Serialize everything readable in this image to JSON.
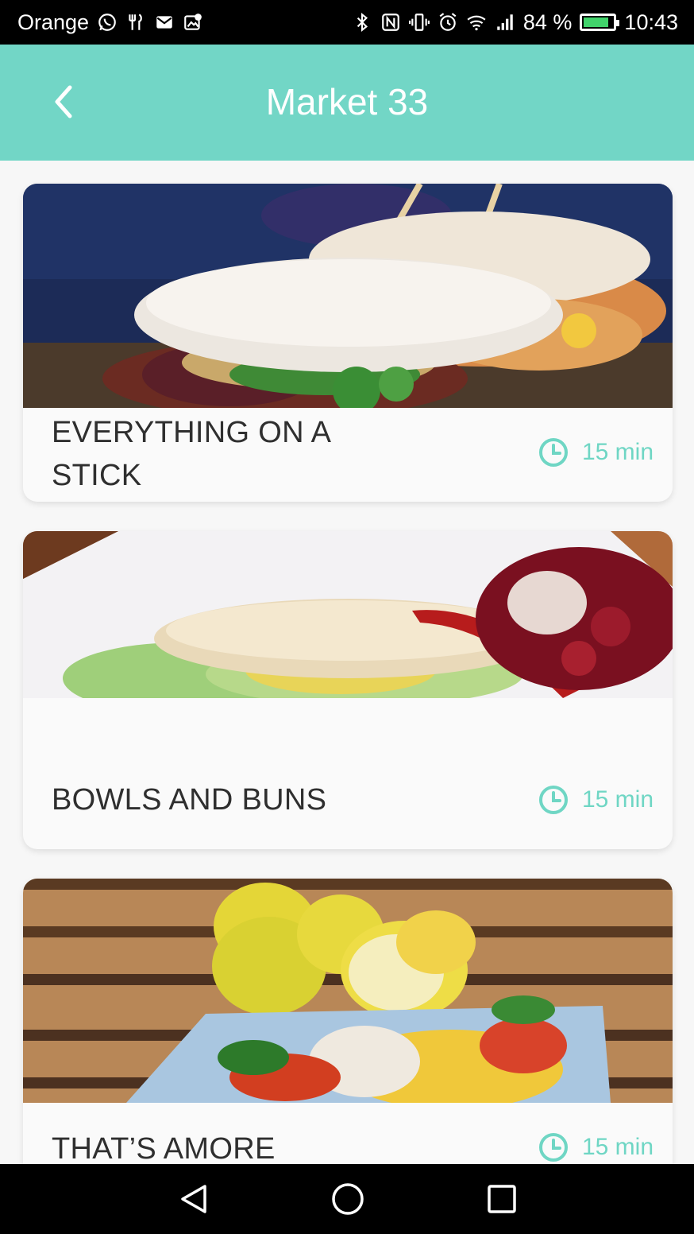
{
  "status_bar": {
    "carrier": "Orange",
    "battery_percent": "84 %",
    "battery_level": 0.84,
    "time": "10:43",
    "left_icons": [
      "whatsapp-icon",
      "restaurant-icon",
      "mail-icon",
      "photo-icon"
    ],
    "right_icons": [
      "bluetooth-icon",
      "nfc-icon",
      "vibrate-icon",
      "alarm-icon",
      "wifi-icon",
      "signal-icon",
      "battery-icon"
    ]
  },
  "header": {
    "title": "Market 33",
    "back_icon": "chevron-left-icon",
    "background": "#72d6c6"
  },
  "restaurants": [
    {
      "name": "EVERYTHING ON A STICK",
      "time": "15 min",
      "image": "sandwich-photo"
    },
    {
      "name": "BOWLS AND BUNS",
      "time": "15 min",
      "image": "pita-bun-photo"
    },
    {
      "name": "THAT’S AMORE",
      "time": "15 min",
      "image": "pasta-lemon-photo"
    }
  ],
  "colors": {
    "accent": "#6fd6c4",
    "text": "#2f2f2f"
  },
  "nav_bar": {
    "buttons": [
      "back-triangle-icon",
      "home-circle-icon",
      "recents-square-icon"
    ]
  }
}
